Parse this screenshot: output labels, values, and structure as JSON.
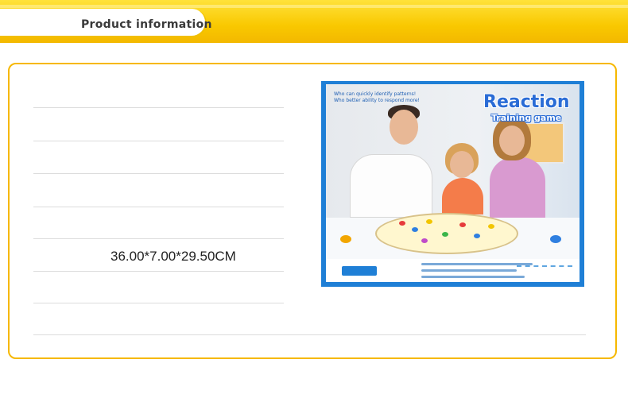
{
  "header": {
    "title": "Product information"
  },
  "product": {
    "dimensions": "36.00*7.00*29.50CM",
    "box": {
      "tagline_1": "Who can quickly identify patterns!",
      "tagline_2": "Who better ability to respond more!",
      "title": "Reaction",
      "subtitle": "Training game"
    }
  },
  "colors": {
    "banner": "#f9c800",
    "frame_border": "#f6b800",
    "box_blue": "#1f7fd6"
  }
}
